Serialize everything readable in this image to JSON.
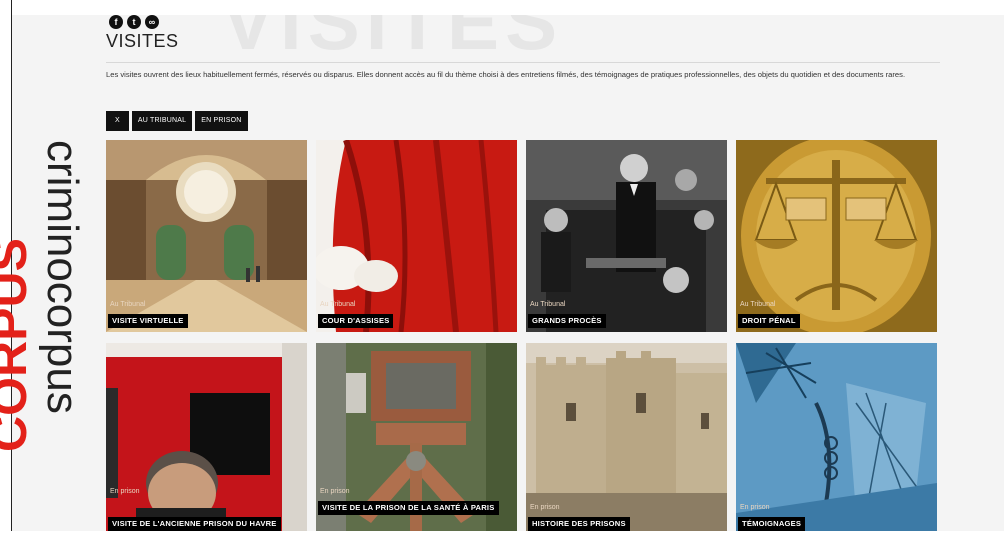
{
  "header": {
    "social": [
      {
        "name": "facebook-icon",
        "glyph": "f"
      },
      {
        "name": "twitter-icon",
        "glyph": "t"
      },
      {
        "name": "link-icon",
        "glyph": "∞"
      }
    ],
    "watermark": "VISITES",
    "title": "VISITES",
    "intro": "Les visites ouvrent des lieux habituellement fermés, réservés ou disparus. Elles donnent accès au fil du thème choisi à des entretiens filmés, des témoignages de pratiques professionnelles, des objets du quotidien et des documents rares."
  },
  "filters": [
    {
      "label": "X"
    },
    {
      "label": "AU TRIBUNAL"
    },
    {
      "label": "EN PRISON"
    }
  ],
  "brand": {
    "word_black": "criminocorpus",
    "word_red": "CORPUS",
    "red": "#e32119"
  },
  "tiles": [
    {
      "category": "Au Tribunal",
      "label": "VISITE VIRTUELLE",
      "icon": "hall-image"
    },
    {
      "category": "Au Tribunal",
      "label": "COUR D'ASSISES",
      "icon": "robe-image"
    },
    {
      "category": "Au Tribunal",
      "label": "GRANDS PROCÈS",
      "icon": "trial-photo"
    },
    {
      "category": "Au Tribunal",
      "label": "DROIT PÉNAL",
      "icon": "scales-image"
    },
    {
      "category": "En prison",
      "label": "VISITE DE L'ANCIENNE PRISON DU HAVRE",
      "icon": "cell-photo"
    },
    {
      "category": "En prison",
      "label": "VISITE DE LA PRISON DE LA SANTÉ À PARIS",
      "icon": "aerial-photo"
    },
    {
      "category": "En prison",
      "label": "HISTOIRE DES PRISONS",
      "icon": "fortress-image"
    },
    {
      "category": "En prison",
      "label": "TÉMOIGNAGES",
      "icon": "engraving-image"
    }
  ]
}
